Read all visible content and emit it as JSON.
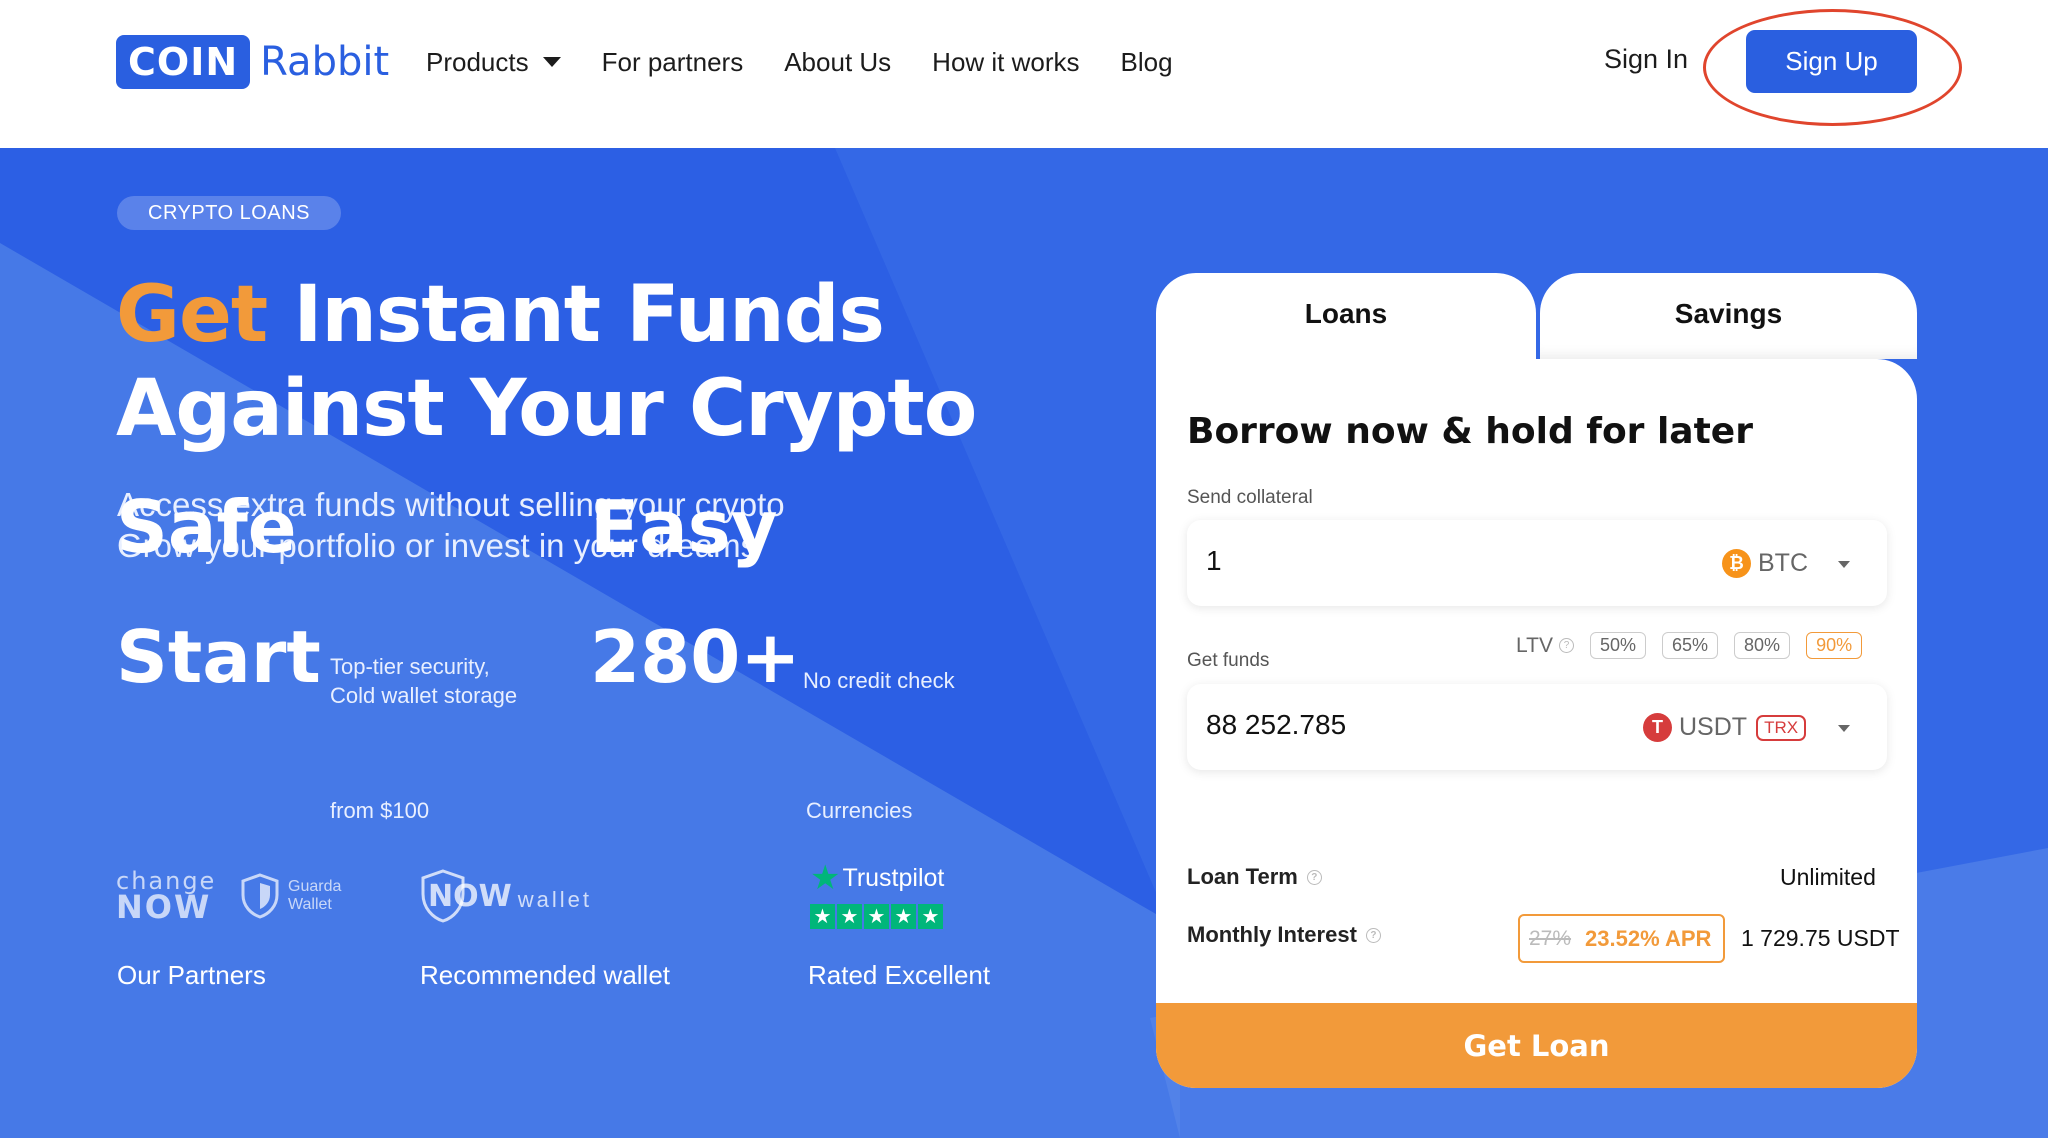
{
  "header": {
    "logo_box": "COIN",
    "logo_text": "Rabbit",
    "nav": [
      {
        "label": "Products"
      },
      {
        "label": "For partners"
      },
      {
        "label": "About Us"
      },
      {
        "label": "How it works"
      },
      {
        "label": "Blog"
      }
    ],
    "sign_in": "Sign In",
    "sign_up": "Sign Up"
  },
  "hero": {
    "pill": "CRYPTO LOANS",
    "headline_accent": "Get",
    "headline_rest": "Instant Funds",
    "headline_line2": "Against Your Crypto",
    "sub_line1": "Access extra funds without selling your crypto",
    "sub_line2": "Grow your portfolio or invest in your dreams",
    "stats": [
      {
        "big": "Safe",
        "small1": "Top-tier security,",
        "small2": "Cold wallet storage"
      },
      {
        "big": "Easy",
        "small1": "No credit check",
        "small2": ""
      },
      {
        "big": "Start",
        "small1": "from $100",
        "small2": ""
      },
      {
        "big": "280+",
        "small1": "Currencies",
        "small2": ""
      }
    ],
    "partners_heading": "Our Partners",
    "wallet_heading": "Recommended wallet",
    "rated_heading": "Rated Excellent",
    "changenow_top": "change",
    "changenow_bottom": "NOW",
    "guarda_line1": "Guarda",
    "guarda_line2": "Wallet",
    "nowwallet_now": "NOW",
    "nowwallet_wallet": "wallet",
    "trustpilot": "Trustpilot",
    "trustpilot_rating": 5
  },
  "card": {
    "tabs": [
      "Loans",
      "Savings"
    ],
    "active_tab": "Loans",
    "title": "Borrow now & hold for later",
    "collateral_label": "Send collateral",
    "collateral_value": "1",
    "collateral_coin": "BTC",
    "funds_label": "Get funds",
    "ltv_label": "LTV",
    "ltv_options": [
      "50%",
      "65%",
      "80%",
      "90%"
    ],
    "ltv_selected": "90%",
    "funds_value": "88 252.785",
    "funds_coin": "USDT",
    "funds_network": "TRX",
    "loan_term_label": "Loan Term",
    "loan_term_value": "Unlimited",
    "monthly_interest_label": "Monthly Interest",
    "apr_old": "27%",
    "apr_new": "23.52% APR",
    "monthly_interest_value": "1 729.75 USDT",
    "cta": "Get Loan"
  },
  "colors": {
    "brand_blue": "#2a5fe0",
    "accent_orange": "#f29a3a",
    "annotation_red": "#e0452d",
    "trustpilot_green": "#00b67a"
  }
}
